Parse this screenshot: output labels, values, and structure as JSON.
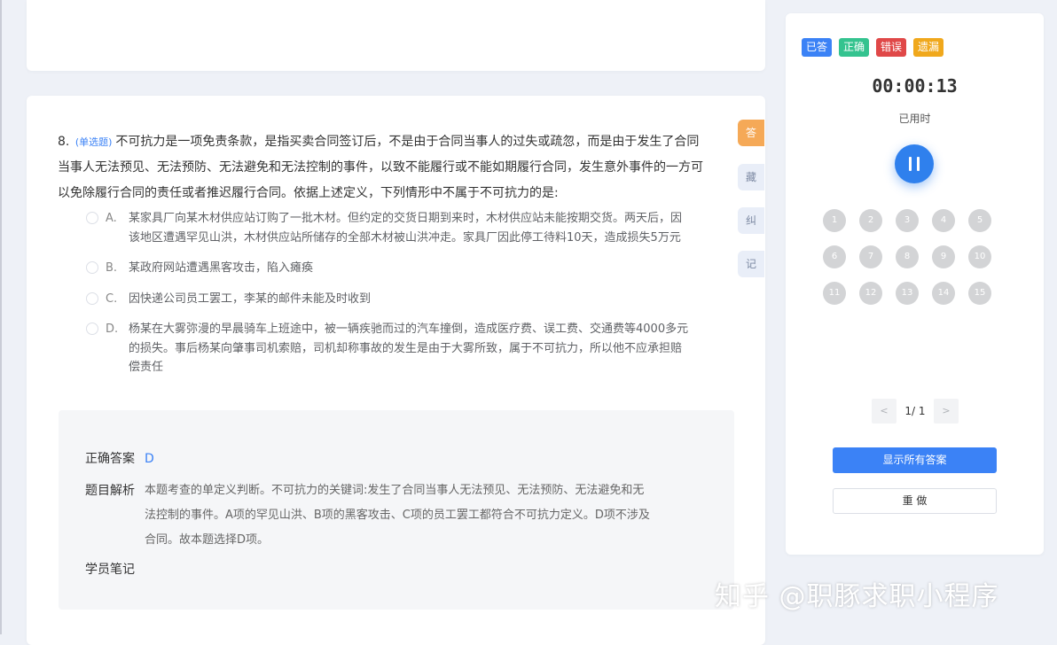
{
  "question": {
    "number": "8.",
    "type": "(单选题)",
    "text": "不可抗力是一项免责条款，是指买卖合同签订后，不是由于合同当事人的过失或疏忽，而是由于发生了合同当事人无法预见、无法预防、无法避免和无法控制的事件，以致不能履行或不能如期履行合同，发生意外事件的一方可以免除履行合同的责任或者推迟履行合同。依据上述定义，下列情形中不属于不可抗力的是:",
    "options": [
      {
        "letter": "A.",
        "text": "某家具厂向某木材供应站订购了一批木材。但约定的交货日期到来时，木材供应站未能按期交货。两天后，因该地区遭遇罕见山洪，木材供应站所储存的全部木材被山洪冲走。家具厂因此停工待料10天，造成损失5万元"
      },
      {
        "letter": "B.",
        "text": "某政府网站遭遇黑客攻击，陷入瘫痪"
      },
      {
        "letter": "C.",
        "text": "因快递公司员工罢工，李某的邮件未能及时收到"
      },
      {
        "letter": "D.",
        "text": "杨某在大雾弥漫的早晨骑车上班途中，被一辆疾驰而过的汽车撞倒，造成医疗费、误工费、交通费等4000多元的损失。事后杨某向肇事司机索赔，司机却称事故的发生是由于大雾所致，属于不可抗力，所以他不应承担赔偿责任"
      }
    ]
  },
  "side_tabs": [
    "答",
    "藏",
    "纠",
    "记"
  ],
  "analysis": {
    "answer_label": "正确答案",
    "answer_value": "D",
    "explain_label": "题目解析",
    "explain_lines": [
      "本题考查的单定义判断。不可抗力的关键词:发生了合同当事人无法预见、无法预防、无法避免和无",
      "法控制的事件。A项的罕见山洪、B项的黑客攻击、C项的员工罢工都符合不可抗力定义。D项不涉及",
      "合同。故本题选择D项。"
    ],
    "notes_label": "学员笔记"
  },
  "panel": {
    "badges": [
      {
        "label": "已答",
        "color": "#3b82f6"
      },
      {
        "label": "正确",
        "color": "#34c38f"
      },
      {
        "label": "错误",
        "color": "#e04848"
      },
      {
        "label": "遗漏",
        "color": "#f0a81c"
      }
    ],
    "timer": "00:00:13",
    "timer_label": "已用时",
    "numbers": [
      "1",
      "2",
      "3",
      "4",
      "5",
      "6",
      "7",
      "8",
      "9",
      "10",
      "11",
      "12",
      "13",
      "14",
      "15"
    ],
    "pager": {
      "prev": "<",
      "text": "1/ 1",
      "next": ">"
    },
    "show_all_label": "显示所有答案",
    "redo_label": "重 做"
  },
  "watermark": "知乎 @职豚求职小程序"
}
